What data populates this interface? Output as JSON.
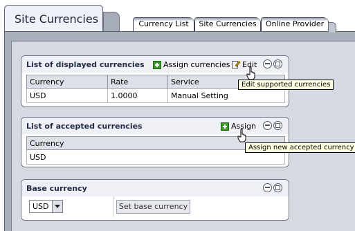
{
  "header": {
    "title": "Site Currencies",
    "tabs": [
      {
        "label": "Currency List"
      },
      {
        "label": "Site Currencies"
      },
      {
        "label": "Online Provider"
      }
    ]
  },
  "displayed": {
    "title": "List of displayed currencies",
    "assign_label": "Assign currencies",
    "edit_label": "Edit",
    "columns": [
      "Currency",
      "Rate",
      "Service"
    ],
    "rows": [
      [
        "USD",
        "1.0000",
        "Manual Setting"
      ]
    ],
    "tooltip": "Edit supported currencies"
  },
  "accepted": {
    "title": "List of accepted currencies",
    "assign_label": "Assign",
    "columns": [
      "Currency"
    ],
    "rows": [
      [
        "USD"
      ]
    ],
    "tooltip": "Assign new accepted currency"
  },
  "base": {
    "title": "Base currency",
    "selected": "USD",
    "button_label": "Set base currency"
  }
}
